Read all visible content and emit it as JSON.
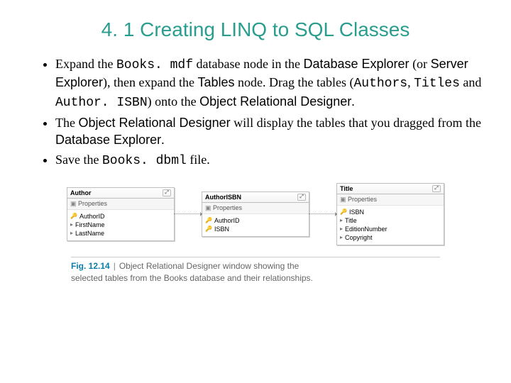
{
  "title": "4. 1 Creating LINQ to SQL Classes",
  "bullets": {
    "b1": {
      "t1": "Expand the ",
      "c1": "Books. mdf",
      "t2": " database node in the ",
      "s1": "Database Explorer",
      "t3": " (or ",
      "s2": "Server Explorer",
      "t4": "), then expand the ",
      "s3": "Tables",
      "t5": " node. Drag the tables (",
      "c2": "Authors",
      "t6": ", ",
      "c3": "Titles",
      "t7": " and ",
      "c4": "Author. ISBN",
      "t8": ") onto the ",
      "s4": "Object Relational Designer",
      "t9": "."
    },
    "b2": {
      "t1": "The ",
      "s1": "Object Relational Designer",
      "t2": " will display the tables that you dragged from the ",
      "s2": "Database Explorer",
      "t3": "."
    },
    "b3": {
      "t1": "Save the ",
      "c1": "Books. dbml",
      "t2": " file."
    }
  },
  "entities": {
    "author": {
      "name": "Author",
      "section": "Properties",
      "fields": [
        "AuthorID",
        "FirstName",
        "LastName"
      ]
    },
    "authorisbn": {
      "name": "AuthorISBN",
      "section": "Properties",
      "fields": [
        "AuthorID",
        "ISBN"
      ]
    },
    "title": {
      "name": "Title",
      "section": "Properties",
      "fields": [
        "ISBN",
        "Title",
        "EditionNumber",
        "Copyright"
      ]
    }
  },
  "pin": "⤢",
  "caption": {
    "fignum": "Fig. 12.14",
    "bar": "|",
    "line1": "Object Relational Designer window showing the",
    "line2": "selected tables from the Books database and their relationships."
  }
}
